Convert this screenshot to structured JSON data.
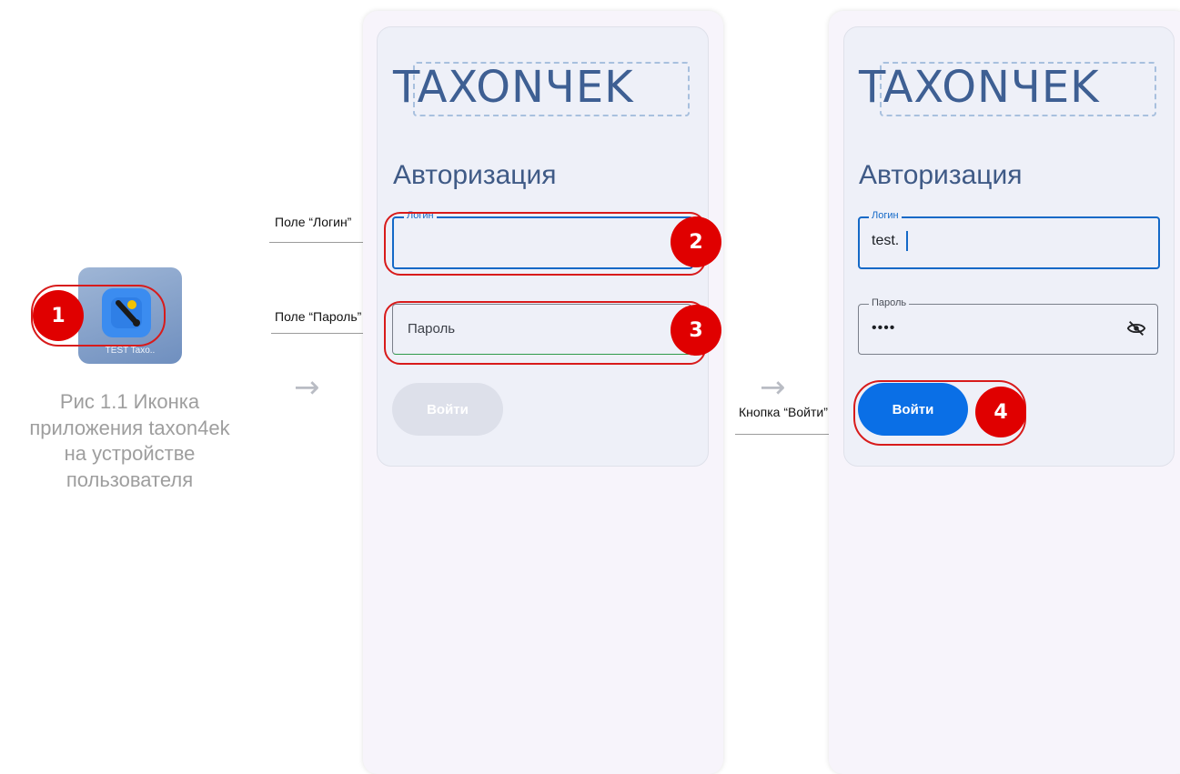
{
  "app_icon": {
    "label": "TEST Taxo.."
  },
  "caption": [
    "Рис 1.1 Иконка",
    "приложения taxon4ek",
    "на устройстве",
    "пользователя"
  ],
  "badges": [
    "1",
    "2",
    "3",
    "4"
  ],
  "annotations": {
    "login_field": "Поле “Логин”",
    "password_field": "Поле “Пароль”",
    "login_button": "Кнопка “Войти”"
  },
  "logo": "TAXONЧEK",
  "screen1": {
    "title": "Авторизация",
    "login_label": "Логин",
    "password_placeholder": "Пароль",
    "button_label": "Войти"
  },
  "screen2": {
    "title": "Авторизация",
    "login_label": "Логин",
    "login_value": "test.",
    "password_label": "Пароль",
    "password_value": "••••",
    "button_label": "Войти"
  },
  "arrows": [
    "→",
    "→"
  ],
  "icons": {
    "app": "wrench-icon",
    "visibility": "eye-off-icon"
  },
  "colors": {
    "accent": "#1469c7",
    "button": "#0a6fe6",
    "highlight": "#d81b1b",
    "badge": "#e00000"
  }
}
